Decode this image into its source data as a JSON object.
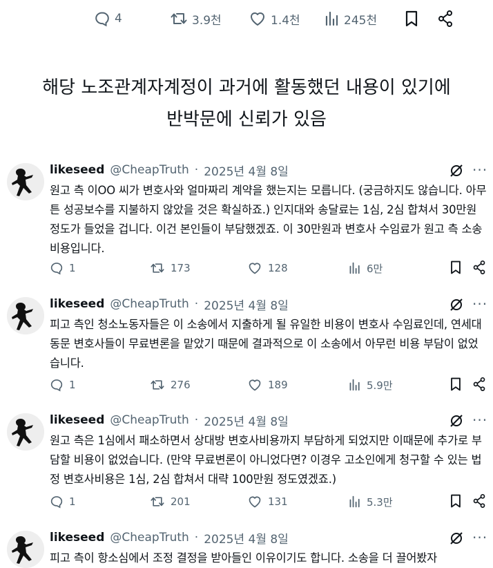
{
  "top_actions": {
    "replies": "4",
    "retweets": "3.9천",
    "likes": "1.4천",
    "views": "245천"
  },
  "headline": {
    "line1": "해당 노조관계자계정이 과거에 활동했던 내용이 있기에",
    "line2": "반박문에 신뢰가 있음"
  },
  "tweets": [
    {
      "name": "likeseed",
      "handle": "@CheapTruth",
      "dot": "·",
      "date": "2025년 4월 8일",
      "text": "원고 측 이OO 씨가 변호사와 얼마짜리 계약을 했는지는 모릅니다. (궁금하지도 않습니다. 아무튼 성공보수를 지불하지 않았을 것은 확실하죠.) 인지대와 송달료는 1심, 2심 합쳐서 30만원 정도가 들었을 겁니다. 이건 본인들이 부담했겠죠. 이 30만원과 변호사 수임료가 원고 측 소송비용입니다.",
      "replies": "1",
      "retweets": "173",
      "likes": "128",
      "views": "6만"
    },
    {
      "name": "likeseed",
      "handle": "@CheapTruth",
      "dot": "·",
      "date": "2025년 4월 8일",
      "text": "피고 측인 청소노동자들은 이 소송에서 지출하게 될 유일한 비용이 변호사 수임료인데, 연세대 동문 변호사들이 무료변론을 맡았기 때문에 결과적으로 이 소송에서 아무런 비용 부담이 없었습니다.",
      "replies": "1",
      "retweets": "276",
      "likes": "189",
      "views": "5.9만"
    },
    {
      "name": "likeseed",
      "handle": "@CheapTruth",
      "dot": "·",
      "date": "2025년 4월 8일",
      "text": "원고 측은 1심에서 패소하면서 상대방 변호사비용까지 부담하게 되었지만 이때문에 추가로 부담할 비용이 없었습니다. (만약 무료변론이 아니었다면? 이경우 고소인에게 청구할 수 있는 법정 변호사비용은 1심, 2심 합쳐서 대략 100만원 정도였겠죠.)",
      "replies": "1",
      "retweets": "201",
      "likes": "131",
      "views": "5.3만"
    },
    {
      "name": "likeseed",
      "handle": "@CheapTruth",
      "dot": "·",
      "date": "2025년 4월 8일",
      "text": "피고 측이 항소심에서 조정 결정을 받아들인 이유이기도 합니다. 소송을 더 끌어봤자"
    }
  ],
  "icons": {
    "reply": "reply-bubble-icon",
    "retweet": "retweet-icon",
    "like": "heart-icon",
    "views": "views-bar-chart-icon",
    "bookmark": "bookmark-icon",
    "share": "share-icon",
    "grok": "grok-slash-circle-icon",
    "more": "more-dots-icon"
  },
  "colors": {
    "text": "#0f1419",
    "muted": "#536471",
    "background": "#ffffff"
  }
}
